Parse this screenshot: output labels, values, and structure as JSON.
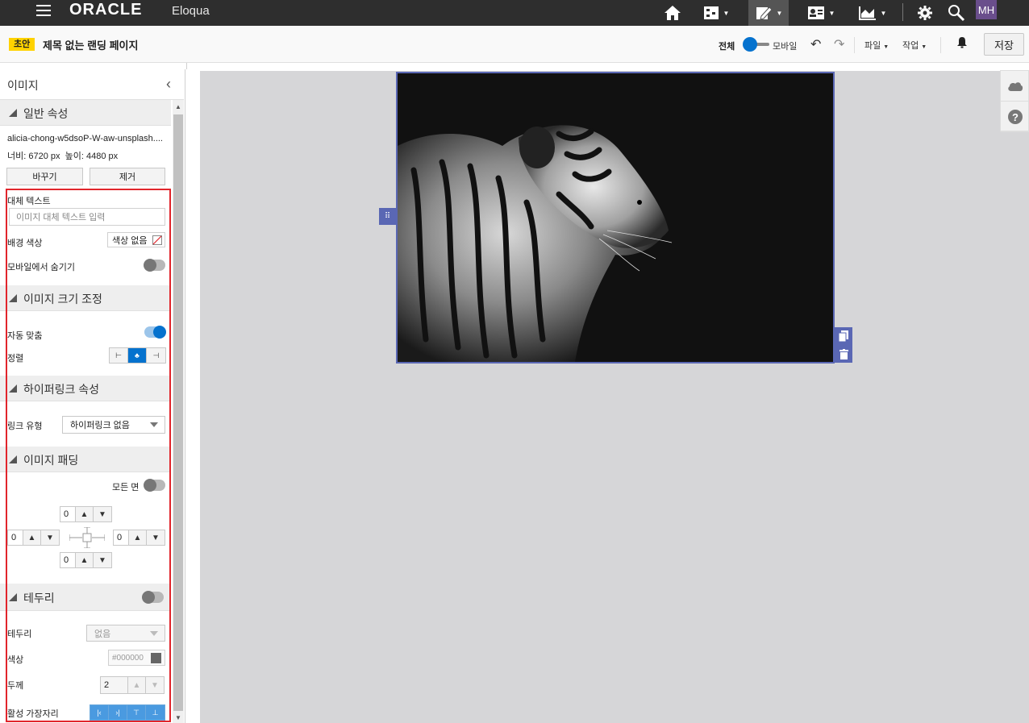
{
  "app": {
    "brand": "ORACLE",
    "product": "Eloqua",
    "avatar": "MH"
  },
  "subheader": {
    "badge": "초안",
    "title": "제목 없는 랜딩 페이지",
    "view_all": "전체",
    "view_mobile": "모바일",
    "file_menu": "파일",
    "actions_menu": "작업",
    "save_label": "저장"
  },
  "panel": {
    "title": "이미지",
    "general": {
      "header": "일반 속성",
      "filename": "alicia-chong-w5dsoP-W-aw-unsplash....",
      "width_label": "너비",
      "width_value": "6720 px",
      "height_label": "높이",
      "height_value": "4480 px",
      "replace_label": "바꾸기",
      "remove_label": "제거",
      "alt_text_label": "대체 텍스트",
      "alt_text_placeholder": "이미지 대체 텍스트 입력",
      "bg_color_label": "배경 색상",
      "bg_color_value": "색상 없음",
      "hide_mobile_label": "모바일에서 숨기기",
      "hide_mobile_on": false
    },
    "sizing": {
      "header": "이미지 크기 조정",
      "auto_fit_label": "자동 맞춤",
      "auto_fit_on": true,
      "align_label": "정렬",
      "align_selected": "center"
    },
    "hyperlink": {
      "header": "하이퍼링크 속성",
      "link_type_label": "링크 유형",
      "link_type_value": "하이퍼링크 없음"
    },
    "padding": {
      "header": "이미지 패딩",
      "all_sides_label": "모든 면",
      "all_sides_on": false,
      "top": "0",
      "left": "0",
      "right": "0",
      "bottom": "0"
    },
    "border": {
      "header": "테두리",
      "enabled": false,
      "style_label": "테두리",
      "style_value": "없음",
      "color_label": "색상",
      "color_value": "#000000",
      "thickness_label": "두께",
      "thickness_value": "2",
      "active_edges_label": "활성 가장자리"
    }
  },
  "colors": {
    "accent": "#0572ce",
    "selection": "#5a67b4",
    "highlight": "#e1252c",
    "nav_bg": "#2e2e2e",
    "badge": "#ffd200"
  }
}
